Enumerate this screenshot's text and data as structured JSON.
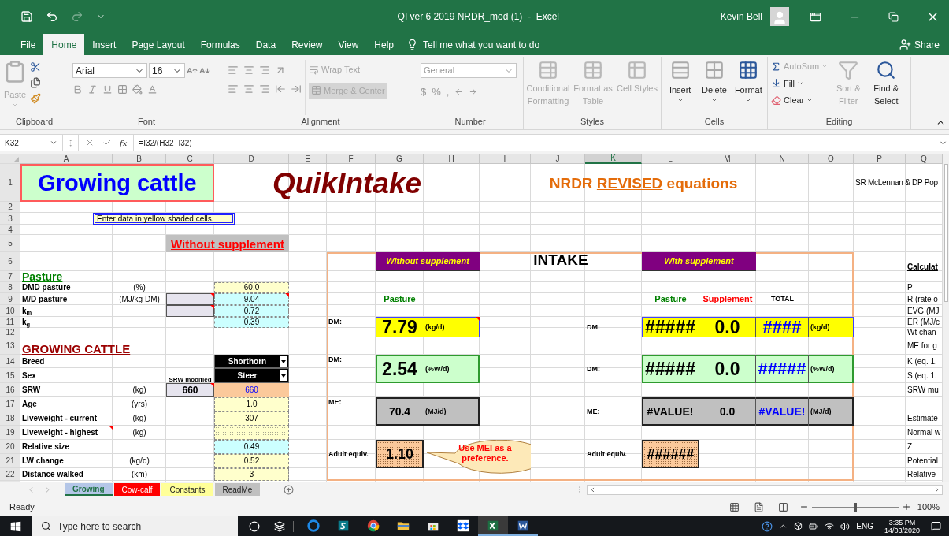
{
  "title_bar": {
    "title": "QI ver 6 2019 NRDR_mod (1)  -  Excel",
    "user": "Kevin Bell"
  },
  "ribbon_tabs": [
    {
      "label": "File",
      "selected": false
    },
    {
      "label": "Home",
      "selected": true
    },
    {
      "label": "Insert",
      "selected": false
    },
    {
      "label": "Page Layout",
      "selected": false
    },
    {
      "label": "Formulas",
      "selected": false
    },
    {
      "label": "Data",
      "selected": false
    },
    {
      "label": "Review",
      "selected": false
    },
    {
      "label": "View",
      "selected": false
    },
    {
      "label": "Help",
      "selected": false
    }
  ],
  "tell_me": {
    "placeholder": "Tell me what you want to do"
  },
  "share": "Share",
  "ribbon": {
    "groups": [
      {
        "label": "Clipboard",
        "kind": "clipboard",
        "buttons": [
          {
            "label": "Paste",
            "disabled": true
          }
        ]
      },
      {
        "label": "Font",
        "kind": "font",
        "font_name": "Arial",
        "font_size": "16"
      },
      {
        "label": "Alignment",
        "kind": "alignment",
        "buttons": [
          {
            "label": "Wrap Text",
            "disabled": true
          },
          {
            "label": "Merge & Center",
            "disabled": true
          }
        ]
      },
      {
        "label": "Number",
        "kind": "number",
        "format": "General",
        "symbols": [
          "$",
          "%",
          ","
        ]
      },
      {
        "label": "Styles",
        "kind": "styles",
        "buttons": [
          {
            "label": "Conditional Formatting",
            "disabled": true
          },
          {
            "label": "Format as Table",
            "disabled": true
          },
          {
            "label": "Cell Styles",
            "disabled": true
          }
        ]
      },
      {
        "label": "Cells",
        "kind": "cells",
        "buttons": [
          {
            "label": "Insert",
            "disabled": false
          },
          {
            "label": "Delete",
            "disabled": false
          },
          {
            "label": "Format",
            "disabled": false
          }
        ]
      },
      {
        "label": "Editing",
        "kind": "editing",
        "buttons": [
          {
            "label": "AutoSum",
            "disabled": true
          },
          {
            "label": "Fill",
            "disabled": false
          },
          {
            "label": "Clear",
            "disabled": false
          },
          {
            "label": "Sort & Filter",
            "disabled": true
          },
          {
            "label": "Find & Select",
            "disabled": false
          }
        ]
      }
    ]
  },
  "formula_bar": {
    "name_box": "K32",
    "fx": "fx",
    "formula": "=I32/(H32+I32)"
  },
  "sheet": {
    "columns": [
      {
        "label": "A",
        "selected": false
      },
      {
        "label": "B",
        "selected": false
      },
      {
        "label": "C",
        "selected": false
      },
      {
        "label": "D",
        "selected": false
      },
      {
        "label": "E",
        "selected": false
      },
      {
        "label": "F",
        "selected": false
      },
      {
        "label": "G",
        "selected": false
      },
      {
        "label": "H",
        "selected": false
      },
      {
        "label": "I",
        "selected": false
      },
      {
        "label": "J",
        "selected": false
      },
      {
        "label": "K",
        "selected": true
      },
      {
        "label": "L",
        "selected": false
      },
      {
        "label": "M",
        "selected": false
      },
      {
        "label": "N",
        "selected": false
      },
      {
        "label": "O",
        "selected": false
      },
      {
        "label": "P",
        "selected": false
      },
      {
        "label": "Q",
        "selected": false
      }
    ],
    "rows": [
      {
        "number": "1",
        "cells": [
          {
            "kind": "banner",
            "text": "Growing cattle"
          },
          {
            "kind": "logo",
            "text": "QuikIntake"
          },
          {
            "kind": "equations",
            "segments": [
              {
                "text": "NRDR ",
                "underline": false
              },
              {
                "text": "REVISED",
                "underline": true
              },
              {
                "text": " equations",
                "underline": false
              }
            ]
          },
          {
            "kind": "author",
            "text": "SR McLennan & DP Pop"
          }
        ]
      },
      {
        "number": "2"
      },
      {
        "number": "3",
        "cells": [
          {
            "kind": "note",
            "text": "Enter data in yellow shaded cells."
          }
        ]
      },
      {
        "number": "4"
      },
      {
        "number": "5",
        "cells": [
          {
            "kind": "banner-red",
            "text": "Without supplement"
          }
        ]
      },
      {
        "number": "6",
        "cells": [
          {
            "kind": "purple",
            "text": "Without supplement"
          },
          {
            "kind": "intake",
            "text": "INTAKE"
          },
          {
            "kind": "purple",
            "text": "With supplement"
          },
          {
            "kind": "heading",
            "text": "Calculat"
          }
        ]
      },
      {
        "number": "7",
        "cells": [
          {
            "kind": "section-green",
            "text": "Pasture"
          }
        ]
      },
      {
        "number": "8",
        "cells": [
          {
            "kind": "label",
            "text": "DMD pasture"
          },
          {
            "kind": "unit",
            "text": "(%)"
          },
          {
            "kind": "input",
            "text": "60.0"
          },
          {
            "kind": "plain",
            "text": "P"
          }
        ]
      },
      {
        "number": "9",
        "cells": [
          {
            "kind": "label",
            "text": "M/D pasture"
          },
          {
            "kind": "unit",
            "text": "(MJ/kg DM)"
          },
          {
            "kind": "lavender"
          },
          {
            "kind": "calc",
            "text": "9.04"
          },
          {
            "kind": "head-green",
            "text": "Pasture"
          },
          {
            "kind": "head-green",
            "text": "Pasture"
          },
          {
            "kind": "head-red",
            "text": "Supplement"
          },
          {
            "kind": "head-small",
            "text": "TOTAL"
          },
          {
            "kind": "plain",
            "text": "R (rate o"
          }
        ]
      },
      {
        "number": "10",
        "cells": [
          {
            "kind": "label",
            "text": "k$_{m}$"
          },
          {
            "kind": "lavender"
          },
          {
            "kind": "calc",
            "text": "0.72"
          },
          {
            "kind": "plain",
            "text": "EVG (MJ"
          }
        ]
      },
      {
        "number": "11",
        "cells": [
          {
            "kind": "label",
            "text": "k$_{g}$"
          },
          {
            "kind": "calc",
            "text": "0.39"
          },
          {
            "kind": "tag-top",
            "text": "DM:"
          },
          {
            "kind": "big",
            "text": "7.79"
          },
          {
            "kind": "unit-bold",
            "text": "(kg/d)"
          },
          {
            "kind": "tag",
            "text": "DM:"
          },
          {
            "kind": "split-big",
            "text": "#####"
          },
          {
            "kind": "split-big",
            "text": "0.0"
          },
          {
            "kind": "split-big-blue",
            "text": "####"
          },
          {
            "kind": "unit-bold",
            "text": "(kg/d)"
          },
          {
            "kind": "plain",
            "text": "ER (MJ/c"
          }
        ]
      },
      {
        "number": "12",
        "cells": [
          {
            "kind": "plain",
            "text": "Wt chan"
          }
        ]
      },
      {
        "number": "13",
        "cells": [
          {
            "kind": "section-maroon",
            "text": "GROWING CATTLE"
          },
          {
            "kind": "plain",
            "text": "ME for g"
          }
        ]
      },
      {
        "number": "14",
        "cells": [
          {
            "kind": "label",
            "text": "Breed"
          },
          {
            "kind": "dropdown",
            "text": "Shorthorn"
          },
          {
            "kind": "tag-top",
            "text": "DM:"
          },
          {
            "kind": "big",
            "text": "2.54"
          },
          {
            "kind": "unit-bold",
            "text": "(%W/d)"
          },
          {
            "kind": "tag",
            "text": "DM:"
          },
          {
            "kind": "split-big",
            "text": "#####"
          },
          {
            "kind": "split-big",
            "text": "0.0"
          },
          {
            "kind": "split-big-blue",
            "text": "#####"
          },
          {
            "kind": "unit-bold",
            "text": "(%W/d)"
          },
          {
            "kind": "plain",
            "text": "K (eq. 1."
          }
        ]
      },
      {
        "number": "15",
        "cells": [
          {
            "kind": "label",
            "text": "Sex"
          },
          {
            "kind": "tiny",
            "text": "SRW modified"
          },
          {
            "kind": "dropdown",
            "text": "Steer"
          },
          {
            "kind": "plain",
            "text": "S (eq. 1."
          }
        ]
      },
      {
        "number": "16",
        "cells": [
          {
            "kind": "label",
            "text": "SRW"
          },
          {
            "kind": "unit",
            "text": "(kg)"
          },
          {
            "kind": "lavender-value",
            "text": "660"
          },
          {
            "kind": "srw",
            "text": "660"
          },
          {
            "kind": "plain",
            "text": "SRW mu"
          }
        ]
      },
      {
        "number": "17",
        "cells": [
          {
            "kind": "label",
            "text": "Age"
          },
          {
            "kind": "unit",
            "text": "(yrs)"
          },
          {
            "kind": "input",
            "text": "1.0"
          },
          {
            "kind": "tag-top",
            "text": "ME:"
          },
          {
            "kind": "medium",
            "text": "70.4"
          },
          {
            "kind": "unit-bold",
            "text": "(MJ/d)"
          },
          {
            "kind": "tag",
            "text": "ME:"
          },
          {
            "kind": "split-medium",
            "text": "#VALUE!"
          },
          {
            "kind": "split-medium",
            "text": "0.0"
          },
          {
            "kind": "split-medium-blue",
            "text": "#VALUE!"
          },
          {
            "kind": "unit-bold",
            "text": "(MJ/d)"
          }
        ]
      },
      {
        "number": "18",
        "cells": [
          {
            "kind": "label",
            "segments": [
              {
                "text": "Liveweight - ",
                "underline": false
              },
              {
                "text": "current",
                "underline": true
              }
            ]
          },
          {
            "kind": "unit",
            "text": "(kg)"
          },
          {
            "kind": "input",
            "text": "307"
          },
          {
            "kind": "plain",
            "text": "Estimate"
          }
        ]
      },
      {
        "number": "19",
        "cells": [
          {
            "kind": "label",
            "text": "Liveweight - highest"
          },
          {
            "kind": "unit",
            "text": "(kg)"
          },
          {
            "kind": "pattern"
          },
          {
            "kind": "plain",
            "text": "Normal w"
          }
        ]
      },
      {
        "number": "20",
        "cells": [
          {
            "kind": "label",
            "text": "Relative size"
          },
          {
            "kind": "calc",
            "text": "0.49"
          },
          {
            "kind": "tag",
            "text": "Adult equiv."
          },
          {
            "kind": "large",
            "text": "1.10"
          },
          {
            "kind": "tag",
            "text": "Adult equiv."
          },
          {
            "kind": "large",
            "text": "######"
          },
          {
            "kind": "plain",
            "text": "Z"
          }
        ]
      },
      {
        "number": "21",
        "cells": [
          {
            "kind": "label",
            "text": "LW change"
          },
          {
            "kind": "unit",
            "text": "(kg/d)"
          },
          {
            "kind": "input",
            "text": "0.52"
          },
          {
            "kind": "plain",
            "text": "Potential"
          }
        ]
      },
      {
        "number": "22",
        "cells": [
          {
            "kind": "label",
            "text": "Distance walked"
          },
          {
            "kind": "unit",
            "text": "(km)"
          },
          {
            "kind": "input",
            "text": "3"
          },
          {
            "kind": "plain",
            "text": "Relative"
          }
        ]
      }
    ],
    "callout": {
      "text": "Use MEI as a preference."
    }
  },
  "sheet_tabs": [
    {
      "label": "Growing",
      "selected": true,
      "color": "#b4c6e7"
    },
    {
      "label": "Cow-calf",
      "selected": false,
      "color": "#ff0000"
    },
    {
      "label": "Constants",
      "selected": false,
      "color": "#ffff99"
    },
    {
      "label": "ReadMe",
      "selected": false,
      "color": "#c0c0c0"
    }
  ],
  "status_bar": {
    "status": "Ready",
    "zoom": {
      "level": 0.5,
      "reading": "100%"
    }
  },
  "taskbar": {
    "search": {
      "placeholder": "Type here to search"
    },
    "apps": [
      {
        "kind": "edge",
        "selected": false,
        "running": false
      },
      {
        "kind": "sway",
        "selected": false,
        "running": false
      },
      {
        "kind": "chrome",
        "selected": false,
        "running": false
      },
      {
        "kind": "explorer",
        "selected": false,
        "running": false
      },
      {
        "kind": "store",
        "selected": false,
        "running": false
      },
      {
        "kind": "dropbox",
        "selected": false,
        "running": false
      },
      {
        "kind": "excel",
        "selected": true,
        "running": true
      },
      {
        "kind": "word",
        "selected": false,
        "running": true
      }
    ],
    "language": "ENG",
    "time": "3:35 PM",
    "date": "14/03/2020"
  }
}
